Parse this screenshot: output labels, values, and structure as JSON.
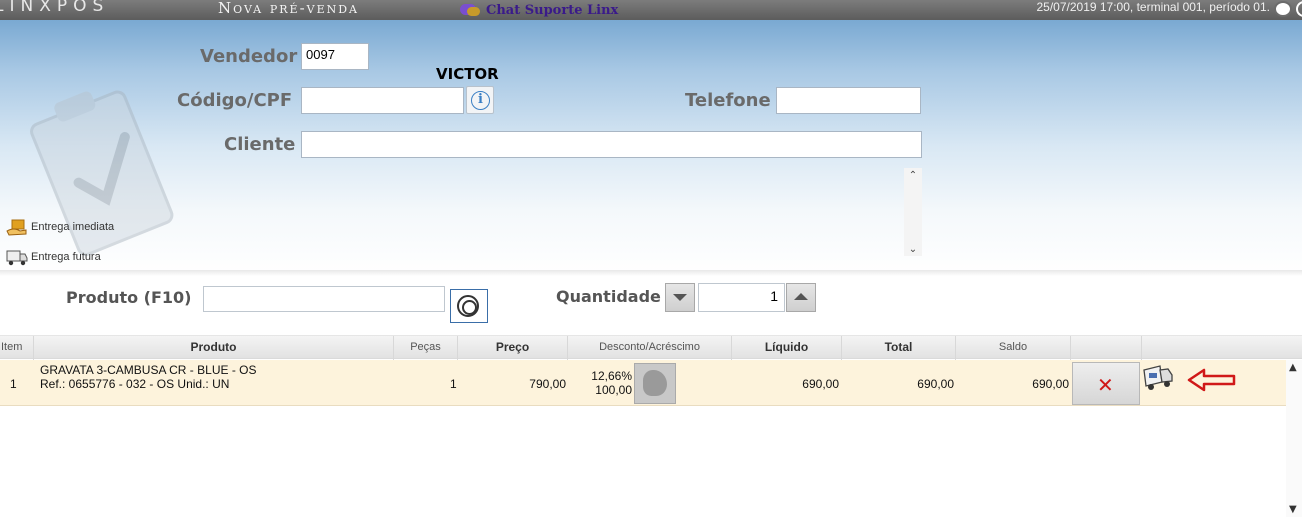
{
  "topbar": {
    "logo": "LINXPOS",
    "screen_title": "Nova pré-venda",
    "chat_label": "Chat Suporte Linx",
    "status": "25/07/2019 17:00, terminal 001, período 01."
  },
  "form": {
    "vendedor_label": "Vendedor",
    "vendedor_code": "0097",
    "vendedor_name": "VICTOR",
    "codigo_label": "Código/CPF",
    "codigo_value": "",
    "telefone_label": "Telefone",
    "telefone_value": "",
    "cliente_label": "Cliente",
    "cliente_value": ""
  },
  "delivery": {
    "imediata": "Entrega imediata",
    "futura": "Entrega futura"
  },
  "product_bar": {
    "produto_label": "Produto (F10)",
    "produto_value": "",
    "quantidade_label": "Quantidade",
    "quantidade_value": "1"
  },
  "table": {
    "headers": [
      "Item",
      "Produto",
      "Peças",
      "Preço",
      "Desconto/Acréscimo",
      "Líquido",
      "Total",
      "Saldo"
    ],
    "rows": [
      {
        "item": "1",
        "produto_line1": "GRAVATA 3-CAMBUSA CR - BLUE - OS",
        "produto_line2": "Ref.: 0655776 - 032 - OS Unid.: UN",
        "pecas": "1",
        "preco": "790,00",
        "desconto_pct": "12,66%",
        "desconto_val": "100,00",
        "liquido": "690,00",
        "total": "690,00",
        "saldo": "690,00"
      }
    ]
  },
  "colors": {
    "accent_red": "#d01818",
    "header_blue": "#7aa9d2",
    "row_highlight": "#fdf3dc"
  }
}
